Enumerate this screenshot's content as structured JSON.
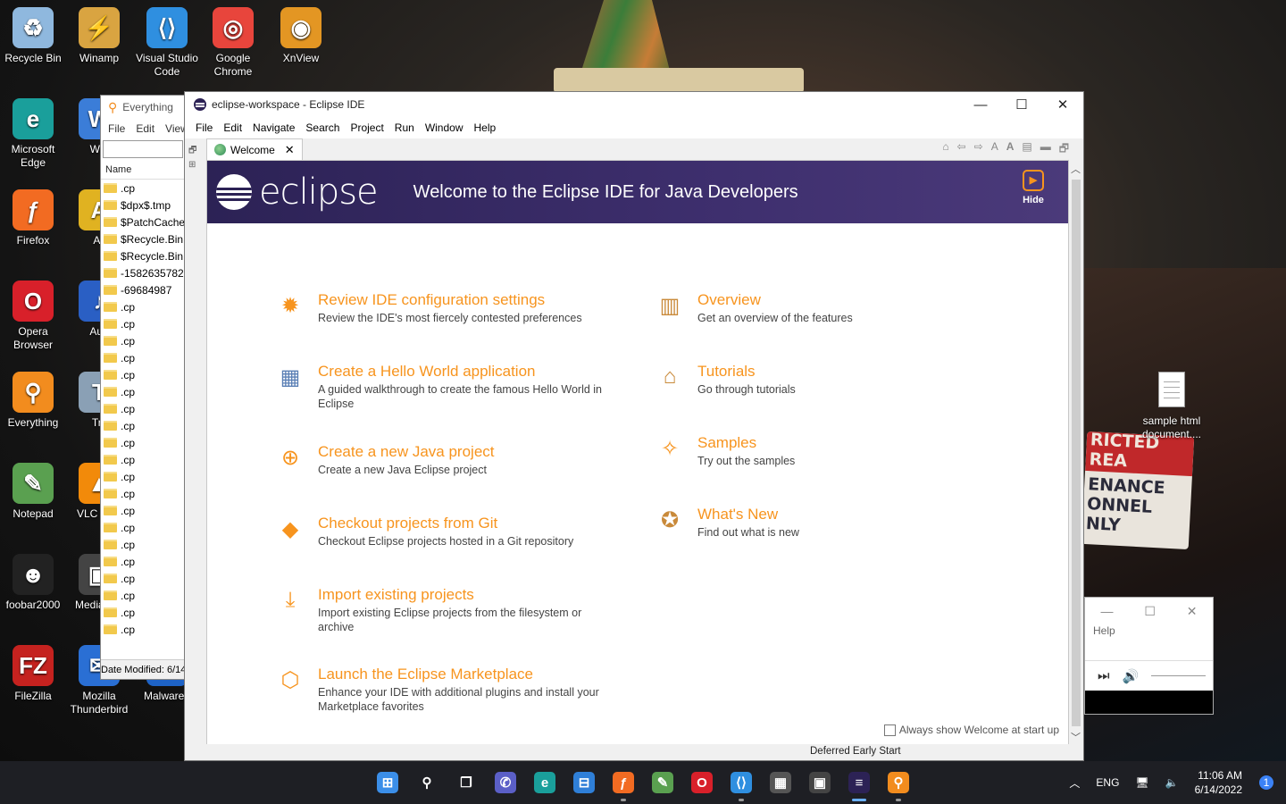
{
  "desktop": {
    "icons": [
      {
        "label": "Recycle Bin",
        "icon": "recycle-bin-icon",
        "color": "#8fb8de",
        "glyph": "♻"
      },
      {
        "label": "Winamp",
        "icon": "winamp-icon",
        "color": "#d9a441",
        "glyph": "⚡"
      },
      {
        "label": "Visual Studio Code",
        "icon": "vscode-icon",
        "color": "#2f8fe0",
        "glyph": "⟨⟩"
      },
      {
        "label": "Google Chrome",
        "icon": "chrome-icon",
        "color": "#e8453c",
        "glyph": "◎"
      },
      {
        "label": "XnView",
        "icon": "xnview-icon",
        "color": "#e39623",
        "glyph": "◉"
      },
      {
        "label": "Microsoft Edge",
        "icon": "edge-icon",
        "color": "#1a9f9b",
        "glyph": "e"
      },
      {
        "label": "Win",
        "icon": "app-icon",
        "color": "#3b7dd8",
        "glyph": "W"
      },
      {
        "label": "Firefox",
        "icon": "firefox-icon",
        "color": "#f26b22",
        "glyph": "ƒ"
      },
      {
        "label": "All",
        "icon": "app-icon",
        "color": "#e0b221",
        "glyph": "A"
      },
      {
        "label": "Opera Browser",
        "icon": "opera-icon",
        "color": "#d8202a",
        "glyph": "O"
      },
      {
        "label": "Aud",
        "icon": "audacity-icon",
        "color": "#2a5fc4",
        "glyph": "♪"
      },
      {
        "label": "Everything",
        "icon": "everything-icon",
        "color": "#f28c1e",
        "glyph": "⚲"
      },
      {
        "label": "Tril",
        "icon": "app-icon",
        "color": "#8aa0b5",
        "glyph": "T"
      },
      {
        "label": "Notepad",
        "icon": "notepad-icon",
        "color": "#5aa050",
        "glyph": "✎"
      },
      {
        "label": "VLC r pla",
        "icon": "vlc-icon",
        "color": "#f28a0a",
        "glyph": "▲"
      },
      {
        "label": "foobar2000",
        "icon": "foobar-icon",
        "color": "#222222",
        "glyph": "☻"
      },
      {
        "label": "Media Cla",
        "icon": "media-icon",
        "color": "#444444",
        "glyph": "▣"
      },
      {
        "label": "FileZilla",
        "icon": "filezilla-icon",
        "color": "#c5221f",
        "glyph": "FZ"
      },
      {
        "label": "Mozilla Thunderbird",
        "icon": "thunderbird-icon",
        "color": "#2a6fd4",
        "glyph": "✉"
      },
      {
        "label": "Malwareb",
        "icon": "malwarebytes-icon",
        "color": "#1e63c6",
        "glyph": "M"
      }
    ],
    "file": {
      "label": "sample html document...."
    }
  },
  "everything": {
    "title": "Everything",
    "menu": [
      "File",
      "Edit",
      "View"
    ],
    "column": "Name",
    "rows": [
      ".cp",
      "$dpx$.tmp",
      "$PatchCache$",
      "$Recycle.Bin",
      "$Recycle.Bin",
      "-1582635782",
      "-69684987",
      ".cp",
      ".cp",
      ".cp",
      ".cp",
      ".cp",
      ".cp",
      ".cp",
      ".cp",
      ".cp",
      ".cp",
      ".cp",
      ".cp",
      ".cp",
      ".cp",
      ".cp",
      ".cp",
      ".cp",
      ".cp",
      ".cp",
      ".cp"
    ],
    "status": "Date Modified: 6/14"
  },
  "eclipse": {
    "title": "eclipse-workspace - Eclipse IDE",
    "menu": [
      "File",
      "Edit",
      "Navigate",
      "Search",
      "Project",
      "Run",
      "Window",
      "Help"
    ],
    "tab": "Welcome",
    "logo": "eclipse",
    "welcome": "Welcome to the Eclipse IDE for Java Developers",
    "hide": "Hide",
    "left": [
      {
        "title": "Review IDE configuration settings",
        "desc": "Review the IDE's most fiercely contested preferences",
        "icon": "gear-icon",
        "glyph": "✹"
      },
      {
        "title": "Create a Hello World application",
        "desc": "A guided walkthrough to create the famous Hello World in Eclipse",
        "icon": "hello-world-icon",
        "glyph": "▦"
      },
      {
        "title": "Create a new Java project",
        "desc": "Create a new Java Eclipse project",
        "icon": "plus-circle-icon",
        "glyph": "⊕"
      },
      {
        "title": "Checkout projects from Git",
        "desc": "Checkout Eclipse projects hosted in a Git repository",
        "icon": "git-icon",
        "glyph": "◆"
      },
      {
        "title": "Import existing projects",
        "desc": "Import existing Eclipse projects from the filesystem or archive",
        "icon": "import-icon",
        "glyph": "⤓"
      },
      {
        "title": "Launch the Eclipse Marketplace",
        "desc": "Enhance your IDE with additional plugins and install your Marketplace favorites",
        "icon": "marketplace-icon",
        "glyph": "⬡"
      }
    ],
    "right": [
      {
        "title": "Overview",
        "desc": "Get an overview of the features",
        "icon": "map-icon",
        "glyph": "▥"
      },
      {
        "title": "Tutorials",
        "desc": "Go through tutorials",
        "icon": "graduation-cap-icon",
        "glyph": "⌂"
      },
      {
        "title": "Samples",
        "desc": "Try out the samples",
        "icon": "magic-wand-icon",
        "glyph": "✧"
      },
      {
        "title": "What's New",
        "desc": "Find out what is new",
        "icon": "star-badge-icon",
        "glyph": "✪"
      }
    ],
    "always_show": "Always show Welcome at start up",
    "status": "Deferred Early Start"
  },
  "media": {
    "help": "Help"
  },
  "taskbar": {
    "apps": [
      {
        "name": "start-icon",
        "color": "#3b8ee8",
        "glyph": "⊞"
      },
      {
        "name": "search-icon",
        "color": "transparent",
        "glyph": "⚲"
      },
      {
        "name": "task-view-icon",
        "color": "transparent",
        "glyph": "❐"
      },
      {
        "name": "chat-icon",
        "color": "#5b5fc7",
        "glyph": "✆"
      },
      {
        "name": "edge-icon",
        "color": "#1a9f9b",
        "glyph": "e"
      },
      {
        "name": "store-icon",
        "color": "#2f7fd8",
        "glyph": "⊟"
      },
      {
        "name": "firefox-icon",
        "color": "#f26b22",
        "glyph": "ƒ"
      },
      {
        "name": "notepad-icon",
        "color": "#5aa050",
        "glyph": "✎"
      },
      {
        "name": "opera-icon",
        "color": "#d8202a",
        "glyph": "O"
      },
      {
        "name": "vscode-icon",
        "color": "#2f8fe0",
        "glyph": "⟨⟩"
      },
      {
        "name": "calculator-icon",
        "color": "#555555",
        "glyph": "▦"
      },
      {
        "name": "media-icon",
        "color": "#444444",
        "glyph": "▣"
      },
      {
        "name": "eclipse-icon",
        "color": "#2c2255",
        "glyph": "≡"
      },
      {
        "name": "everything-icon",
        "color": "#f28c1e",
        "glyph": "⚲"
      }
    ],
    "lang": "ENG",
    "time": "11:06 AM",
    "date": "6/14/2022",
    "notifications": "1"
  }
}
